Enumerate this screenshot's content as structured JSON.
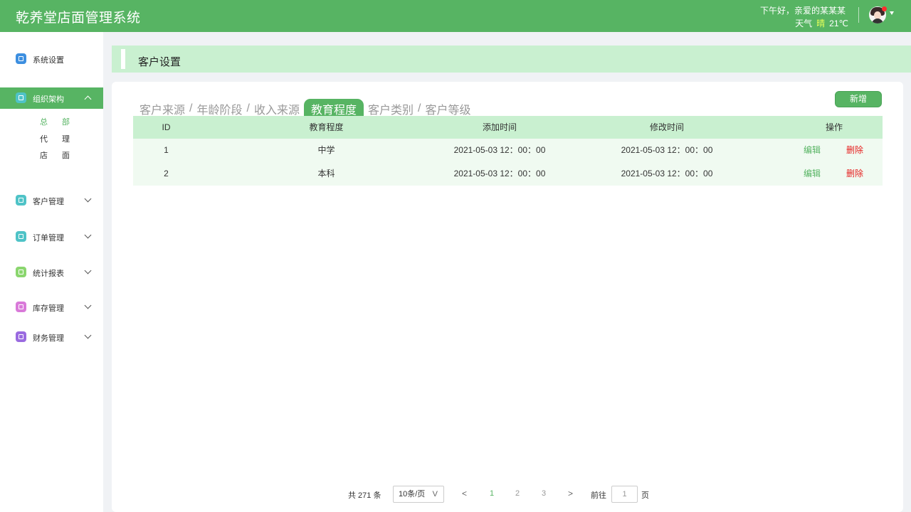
{
  "header": {
    "app_title": "乾养堂店面管理系统",
    "greeting": "下午好，亲爱的某某某",
    "weather_label": "天气",
    "weather_condition": "晴",
    "temperature": "21℃"
  },
  "sidebar": {
    "items": [
      {
        "label": "系统设置",
        "icon": "home-icon",
        "color": "#3d8fe0"
      },
      {
        "label": "组织架构",
        "icon": "gear-icon",
        "color": "#4fc3c7",
        "expanded": true
      },
      {
        "label": "客户管理",
        "icon": "home-icon",
        "color": "#4fc3c7"
      },
      {
        "label": "订单管理",
        "icon": "home-icon",
        "color": "#4fc3c7"
      },
      {
        "label": "统计报表",
        "icon": "gear-icon",
        "color": "#8bd66f"
      },
      {
        "label": "库存管理",
        "icon": "home-icon",
        "color": "#d97ad9"
      },
      {
        "label": "财务管理",
        "icon": "gear-icon",
        "color": "#9a6be0"
      }
    ],
    "sub_items": [
      "总部",
      "代理",
      "店面"
    ]
  },
  "section_title": "客户设置",
  "tabs": [
    {
      "label": "客户来源",
      "active": false
    },
    {
      "label": "年龄阶段",
      "active": false
    },
    {
      "label": "收入来源",
      "active": false
    },
    {
      "label": "教育程度",
      "active": true
    },
    {
      "label": "客户类别",
      "active": false
    },
    {
      "label": "客户等级",
      "active": false
    }
  ],
  "tab_separator": "/",
  "add_button": "新增",
  "table": {
    "headers": {
      "id": "ID",
      "education": "教育程度",
      "added": "添加时间",
      "modified": "修改时间",
      "actions": "操作"
    },
    "rows": [
      {
        "id": "1",
        "education": "中学",
        "added": "2021-05-03 12：00：00",
        "modified": "2021-05-03 12：00：00"
      },
      {
        "id": "2",
        "education": "本科",
        "added": "2021-05-03 12：00：00",
        "modified": "2021-05-03 12：00：00"
      }
    ],
    "edit_label": "编辑",
    "delete_label": "删除"
  },
  "pagination": {
    "total": "共 271 条",
    "page_size": "10条/页",
    "page_size_caret": "V",
    "prev": "<",
    "pages": [
      "1",
      "2",
      "3"
    ],
    "current_page": "1",
    "next": ">",
    "goto_label": "前往",
    "goto_value": "1",
    "page_unit": "页"
  },
  "colors": {
    "primary": "#57b463",
    "header_bg": "#57b463",
    "table_header_bg": "#c9f0d0",
    "row_bg": "#f0faf1",
    "delete": "#e62121"
  }
}
